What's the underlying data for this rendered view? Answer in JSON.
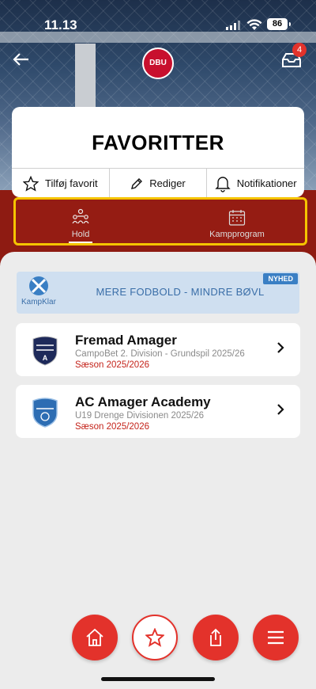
{
  "status_bar": {
    "time": "11.13",
    "battery": "86"
  },
  "header": {
    "logo_text": "DBU",
    "notification_count": "4"
  },
  "page": {
    "title": "FAVORITTER",
    "actions": [
      {
        "label": "Tilføj favorit",
        "icon": "star-outline-icon"
      },
      {
        "label": "Rediger",
        "icon": "pencil-icon"
      },
      {
        "label": "Notifikationer",
        "icon": "bell-icon"
      }
    ]
  },
  "tabs": [
    {
      "label": "Hold",
      "icon": "team-icon",
      "active": true
    },
    {
      "label": "Kampprogram",
      "icon": "calendar-icon",
      "active": false
    }
  ],
  "banner": {
    "logo_label": "KampKlar",
    "text": "MERE FODBOLD - MINDRE BØVL",
    "tag": "NYHED"
  },
  "teams": [
    {
      "name": "Fremad Amager",
      "league": "CampoBet 2. Division - Grundspil 2025/26",
      "season": "Sæson 2025/2026"
    },
    {
      "name": "AC Amager Academy",
      "league": "U19 Drenge Divisionen 2025/26",
      "season": "Sæson 2025/2026"
    }
  ],
  "bottom_nav": [
    {
      "name": "home",
      "icon": "home-icon"
    },
    {
      "name": "favorites",
      "icon": "star-icon",
      "active": true
    },
    {
      "name": "share",
      "icon": "share-icon"
    },
    {
      "name": "menu",
      "icon": "hamburger-menu-icon"
    }
  ],
  "colors": {
    "brand_red": "#e3322b",
    "band_red": "#8e1b12",
    "highlight": "#f5c400",
    "accent_blue": "#3a7fc4"
  }
}
